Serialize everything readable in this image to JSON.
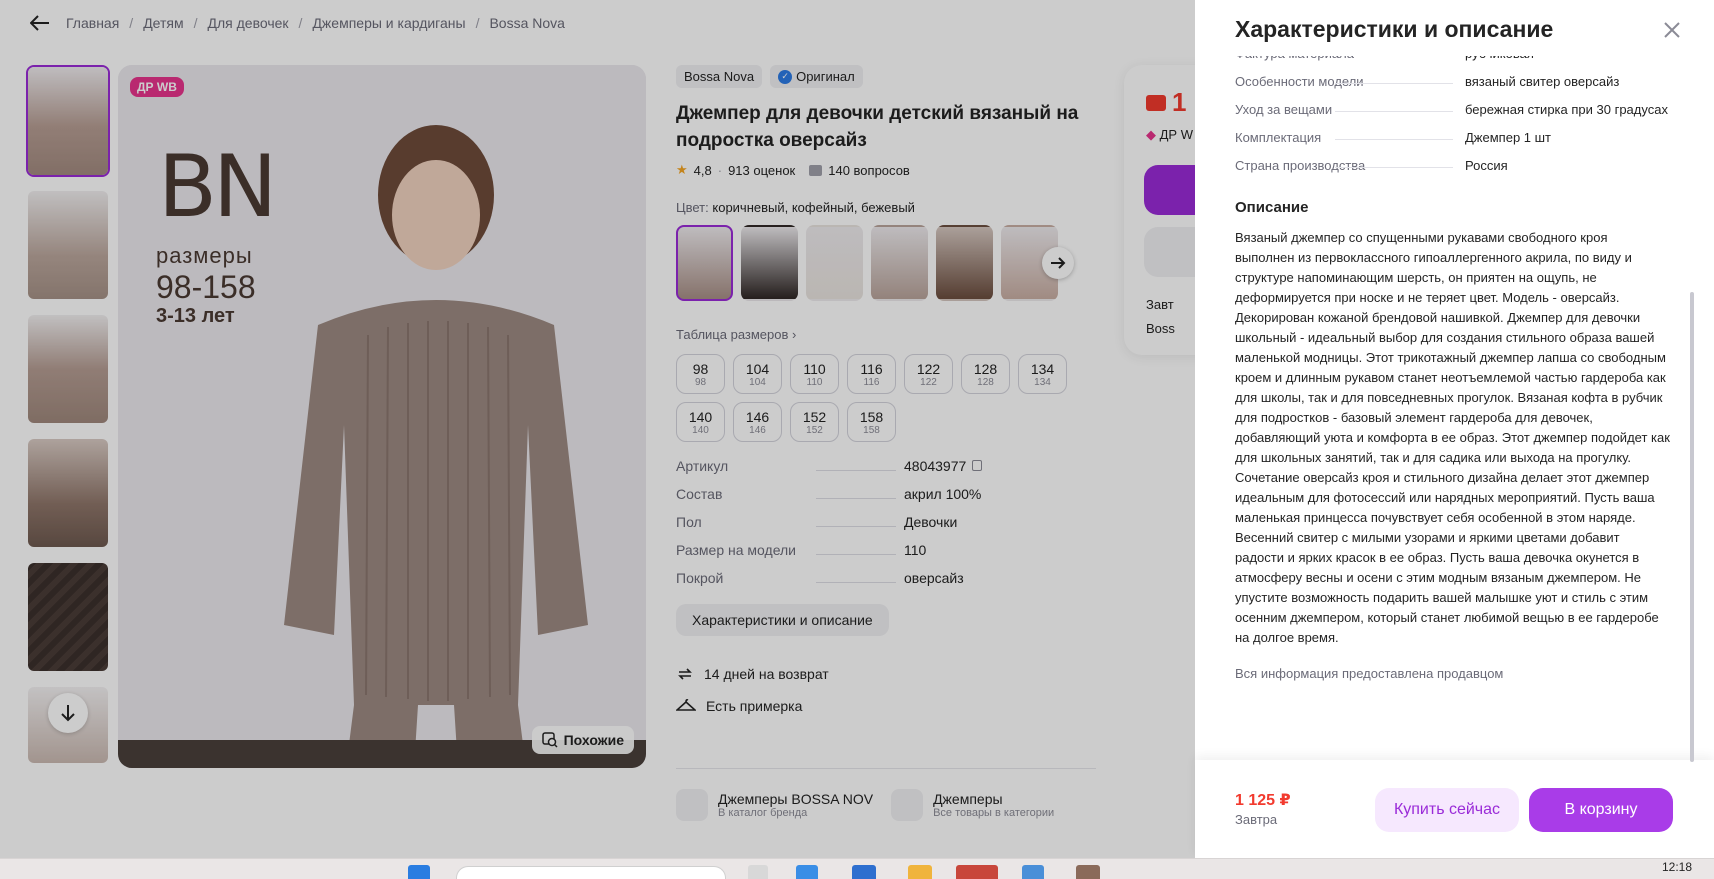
{
  "breadcrumbs": [
    "Главная",
    "Детям",
    "Для девочек",
    "Джемперы и кардиганы",
    "Bossa Nova"
  ],
  "photo": {
    "badge": "ДР WB",
    "logo": "BN",
    "sizes_label": "размеры",
    "sizes_range": "98-158",
    "ages": "3-13 лет",
    "similar": "Похожие"
  },
  "product": {
    "brand": "Bossa Nova",
    "original": "Оригинал",
    "title": "Джемпер для девочки детский вязаный на подростка оверсайз",
    "rating": "4,8",
    "reviews": "913 оценок",
    "questions": "140 вопросов",
    "color_label": "Цвет:",
    "color_value": "коричневый, кофейный, бежевый",
    "size_table": "Таблица размеров",
    "sizes": [
      {
        "size": "98",
        "sub": "98"
      },
      {
        "size": "104",
        "sub": "104"
      },
      {
        "size": "110",
        "sub": "110"
      },
      {
        "size": "116",
        "sub": "116"
      },
      {
        "size": "122",
        "sub": "122"
      },
      {
        "size": "128",
        "sub": "128"
      },
      {
        "size": "134",
        "sub": "134"
      },
      {
        "size": "140",
        "sub": "140"
      },
      {
        "size": "146",
        "sub": "146"
      },
      {
        "size": "152",
        "sub": "152"
      },
      {
        "size": "158",
        "sub": "158"
      }
    ],
    "params": [
      {
        "k": "Артикул",
        "v": "48043977"
      },
      {
        "k": "Состав",
        "v": "акрил 100%"
      },
      {
        "k": "Пол",
        "v": "Девочки"
      },
      {
        "k": "Размер на модели",
        "v": "110"
      },
      {
        "k": "Покрой",
        "v": "оверсайз"
      }
    ],
    "char_button": "Характеристики и описание",
    "perks": [
      "14 дней на возврат",
      "Есть примерка"
    ],
    "links": [
      {
        "t1": "Джемперы BOSSA NOV",
        "t2": "В каталог бренда"
      },
      {
        "t1": "Джемперы",
        "t2": "Все товары в категории"
      }
    ]
  },
  "buybox": {
    "price_partial": "1",
    "drwb": "ДР W",
    "line1": "Завт",
    "line2": "Boss"
  },
  "panel": {
    "title": "Характеристики и описание",
    "rows": [
      {
        "k": "Фактура материала",
        "v": "рубчиковая"
      },
      {
        "k": "Особенности модели",
        "v": "вязаный свитер оверсайз"
      },
      {
        "k": "Уход за вещами",
        "v": "бережная стирка при 30 градусах"
      },
      {
        "k": "Комплектация",
        "v": "Джемпер 1 шт"
      },
      {
        "k": "Страна производства",
        "v": "Россия"
      }
    ],
    "desc_title": "Описание",
    "description": "Вязаный джемпер со спущенными рукавами свободного кроя выполнен из первоклассного гипоаллергенного акрила, по виду и структуре напоминающим шерсть, он приятен на ощупь, не деформируется при носке и не теряет цвет. Модель - оверсайз. Декорирован кожаной брендовой нашивкой. Джемпер для девочки школьный - идеальный выбор для создания стильного образа вашей маленькой модницы. Этот трикотажный джемпер лапша со свободным кроем и длинным рукавом станет неотъемлемой частью гардероба как для школы, так и для повседневных прогулок. Вязаная кофта в рубчик для подростков - базовый элемент гардероба для девочек, добавляющий уюта и комфорта в ее образ. Этот джемпер подойдет как для школьных занятий, так и для садика или выхода на прогулку. Сочетание оверсайз кроя и стильного дизайна делает этот джемпер идеальным для фотосессий или нарядных мероприятий. Пусть ваша маленькая принцесса почувствует себя особенной в этом наряде. Весенний свитер с милыми узорами и яркими цветами добавит радости и ярких красок в ее образ. Пусть ваша девочка окунется в атмосферу весны и осени с этим модным вязаным джемпером. Не упустите возможность подарить вашей малышке уют и стиль с этим осенним джемпером, который станет любимой вещью в ее гардеробе на долгое время.",
    "seller_note": "Вся информация предоставлена продавцом",
    "price": "1 125 ₽",
    "delivery": "Завтра",
    "buy_now": "Купить сейчас",
    "to_cart": "В корзину"
  },
  "taskbar": {
    "clock": "12:18"
  },
  "colors": {
    "accent": "#9a2bd8",
    "price": "#f23a2e",
    "badge": "#e8348c"
  }
}
